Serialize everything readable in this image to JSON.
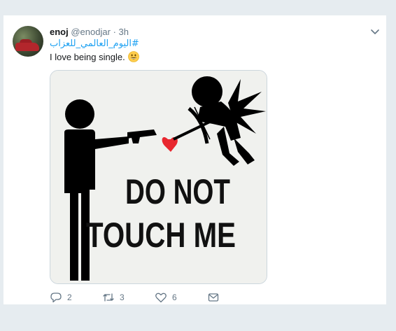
{
  "tweet": {
    "author_name": "enoj",
    "author_handle": "@enodjar",
    "separator": "·",
    "time": "3h",
    "hashtag": "#اليوم_العالمي_للعزاب",
    "text": "I love being single.",
    "emoji_icon": "smiling-face-emoji",
    "media": {
      "line1": "DO NOT",
      "line2": "TOUCH ME"
    },
    "actions": {
      "reply_count": "2",
      "retweet_count": "3",
      "like_count": "6"
    }
  },
  "colors": {
    "link": "#1da1f2",
    "muted": "#657786",
    "background": "#e6ecf0"
  }
}
